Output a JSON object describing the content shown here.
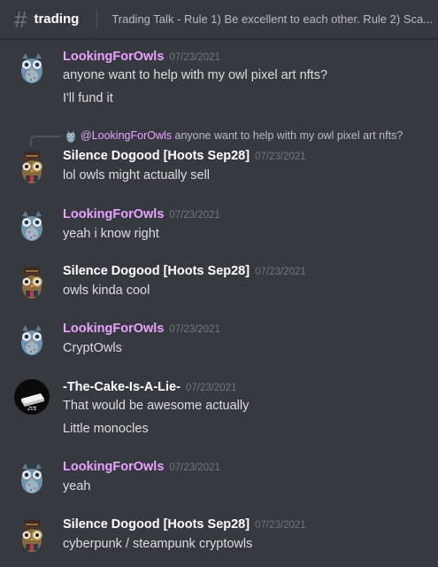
{
  "channel": {
    "icon": "hash-icon",
    "name": "trading",
    "topic": "Trading Talk - Rule 1) Be excellent to each other. Rule 2) Sca..."
  },
  "colors": {
    "owls_name": "#e9a3ff",
    "white_name": "#ffffff",
    "bg": "#36393f"
  },
  "reply": {
    "mention": "@LookingForOwls",
    "text": "anyone want to help with my owl pixel art nfts?"
  },
  "messages": [
    {
      "author": "LookingForOwls",
      "timestamp": "07/23/2021",
      "lines": [
        "anyone want to help with my owl pixel art nfts?",
        "I'll fund it"
      ]
    },
    {
      "author": "Silence Dogood [Hoots Sep28]",
      "timestamp": "07/23/2021",
      "lines": [
        "lol owls might actually sell"
      ]
    },
    {
      "author": "LookingForOwls",
      "timestamp": "07/23/2021",
      "lines": [
        "yeah i know right"
      ]
    },
    {
      "author": "Silence Dogood [Hoots Sep28]",
      "timestamp": "07/23/2021",
      "lines": [
        "owls kinda cool"
      ]
    },
    {
      "author": "LookingForOwls",
      "timestamp": "07/23/2021",
      "lines": [
        "CryptOwls"
      ]
    },
    {
      "author": "-The-Cake-Is-A-Lie-",
      "timestamp": "07/23/2021",
      "lines": [
        "That would be awesome actually",
        "Little monocles"
      ]
    },
    {
      "author": "LookingForOwls",
      "timestamp": "07/23/2021",
      "lines": [
        "yeah"
      ]
    },
    {
      "author": "Silence Dogood [Hoots Sep28]",
      "timestamp": "07/23/2021",
      "lines": [
        "cyberpunk / steampunk cryptowls"
      ]
    }
  ]
}
